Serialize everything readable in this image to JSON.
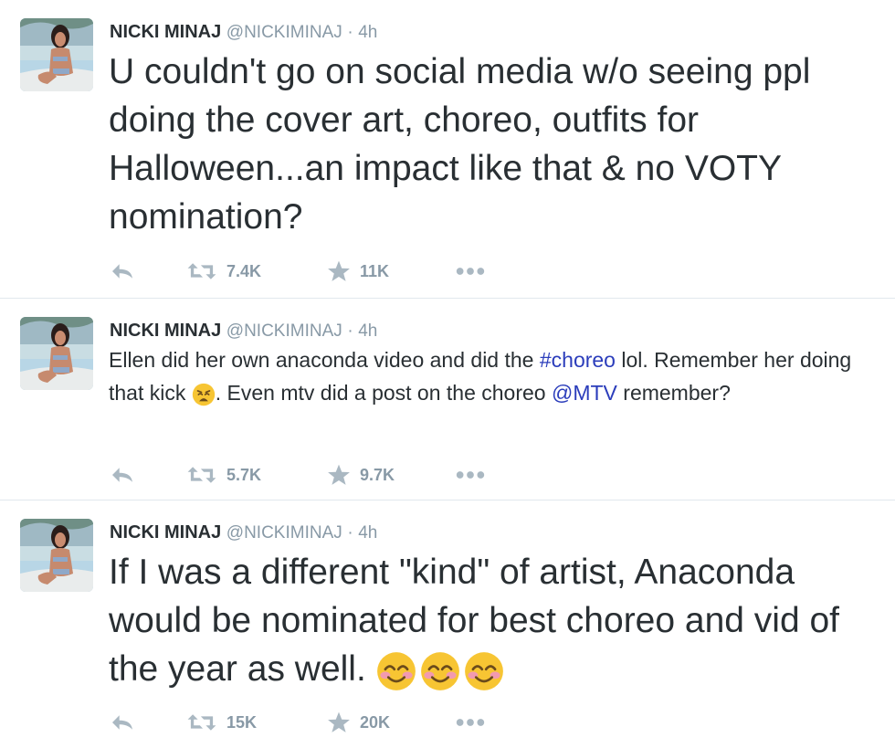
{
  "tweets": [
    {
      "author_name": "NICKI MINAJ",
      "handle": "@NICKIMINAJ",
      "separator": "·",
      "time": "4h",
      "text_parts": [
        "U couldn't go on social media w/o seeing ppl doing the cover art, choreo, outfits for Halloween...an impact like that & no VOTY nomination?"
      ],
      "retweets": "7.4K",
      "favorites": "11K"
    },
    {
      "author_name": "NICKI MINAJ",
      "handle": "@NICKIMINAJ",
      "separator": "·",
      "time": "4h",
      "text_parts": [
        "Ellen did her own anaconda video and did the ",
        "#choreo",
        " lol. Remember her doing that kick ",
        ". Even mtv did a post on the choreo ",
        "@MTV",
        " remember?"
      ],
      "emoji": "weary-face",
      "retweets": "5.7K",
      "favorites": "9.7K"
    },
    {
      "author_name": "NICKI MINAJ",
      "handle": "@NICKIMINAJ",
      "separator": "·",
      "time": "4h",
      "text_parts": [
        "If I was a different \"kind\" of artist, Anaconda would be nominated for best choreo and vid of the year as well. "
      ],
      "emoji": "smiling-face-with-smiling-eyes",
      "emoji_count": 3,
      "retweets": "15K",
      "favorites": "20K"
    }
  ],
  "colors": {
    "text": "#292f33",
    "meta": "#8899a6",
    "icons": "#aab8c2",
    "link": "#2b3dbb",
    "divider": "#e1e8ed"
  },
  "icons": [
    "reply-icon",
    "retweet-icon",
    "favorite-star-icon",
    "more-dots-icon"
  ]
}
